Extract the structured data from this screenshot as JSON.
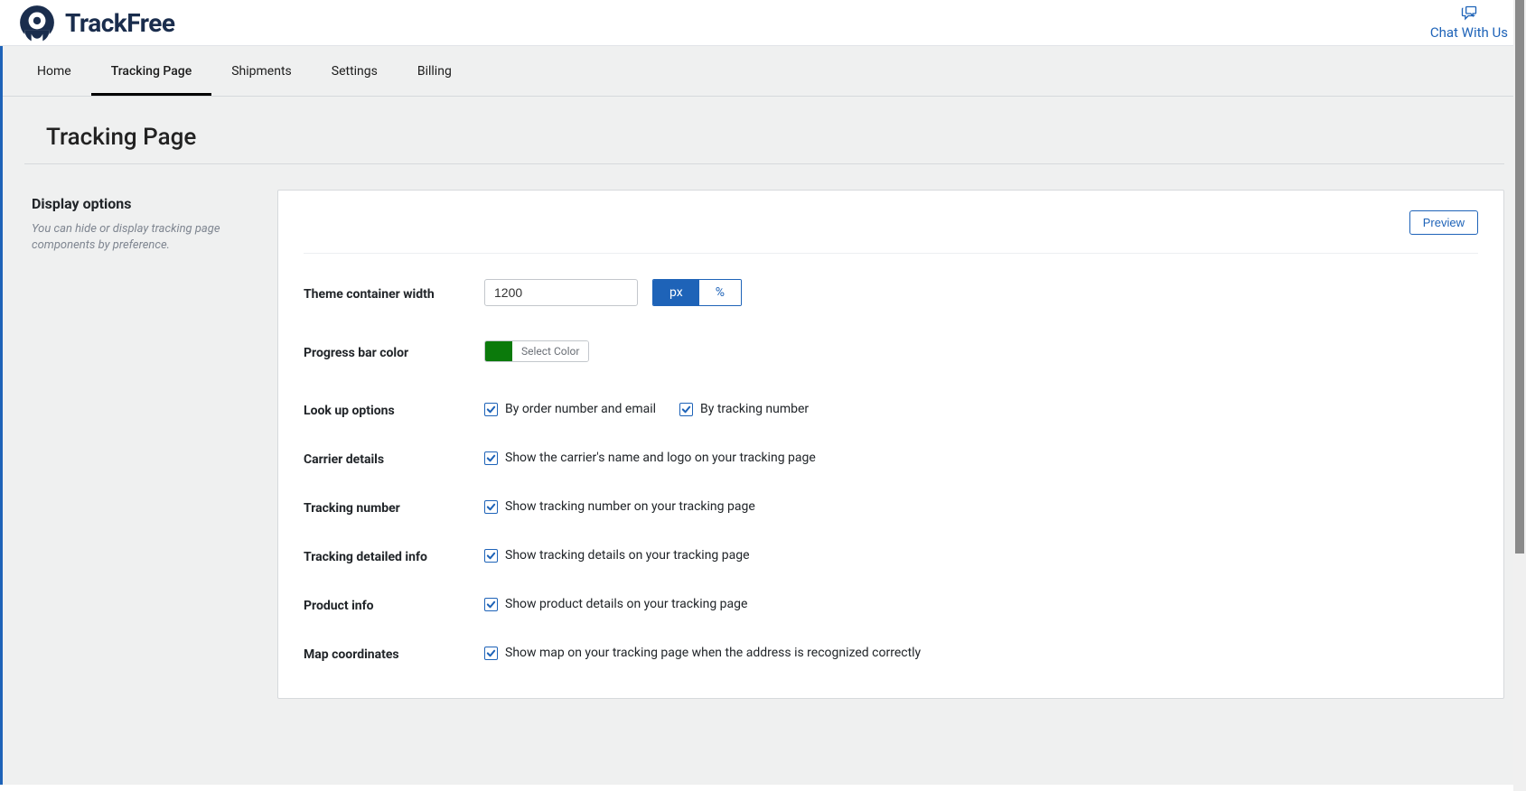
{
  "header": {
    "brand_name": "TrackFree",
    "chat_label": "Chat With Us"
  },
  "nav": {
    "tabs": [
      {
        "label": "Home",
        "active": false
      },
      {
        "label": "Tracking Page",
        "active": true
      },
      {
        "label": "Shipments",
        "active": false
      },
      {
        "label": "Settings",
        "active": false
      },
      {
        "label": "Billing",
        "active": false
      }
    ]
  },
  "page": {
    "title": "Tracking Page"
  },
  "sidebar": {
    "heading": "Display options",
    "description": "You can hide or display tracking page components by preference."
  },
  "panel": {
    "preview_label": "Preview",
    "rows": {
      "theme_width": {
        "label": "Theme container width",
        "value": "1200",
        "unit_px": "px",
        "unit_pct": "%",
        "unit_active": "px"
      },
      "progress_color": {
        "label": "Progress bar color",
        "button_label": "Select Color",
        "color": "#0b7a0b"
      },
      "lookup": {
        "label": "Look up options",
        "options": [
          {
            "text": "By order number and email",
            "checked": true
          },
          {
            "text": "By tracking number",
            "checked": true
          }
        ]
      },
      "carrier": {
        "label": "Carrier details",
        "option": {
          "text": "Show the carrier's name and logo on your tracking page",
          "checked": true
        }
      },
      "tracking_no": {
        "label": "Tracking number",
        "option": {
          "text": "Show tracking number on your tracking page",
          "checked": true
        }
      },
      "tracking_detail": {
        "label": "Tracking detailed info",
        "option": {
          "text": "Show tracking details on your tracking page",
          "checked": true
        }
      },
      "product": {
        "label": "Product info",
        "option": {
          "text": "Show product details on your tracking page",
          "checked": true
        }
      },
      "map": {
        "label": "Map coordinates",
        "option": {
          "text": "Show map on your tracking page when the address is recognized correctly",
          "checked": true
        }
      }
    }
  }
}
